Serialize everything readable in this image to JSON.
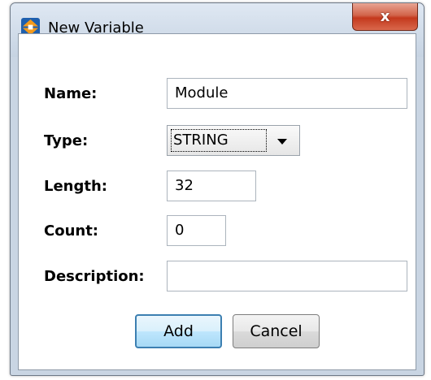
{
  "window": {
    "title": "New Variable",
    "close_label": "x"
  },
  "form": {
    "name": {
      "label": "Name:",
      "value": "Module"
    },
    "type": {
      "label": "Type:",
      "value": "STRING"
    },
    "length": {
      "label": "Length:",
      "value": "32"
    },
    "count": {
      "label": "Count:",
      "value": "0"
    },
    "description": {
      "label": "Description:",
      "value": ""
    }
  },
  "buttons": {
    "add": "Add",
    "cancel": "Cancel"
  },
  "colors": {
    "titlebar": "#c9d5e3",
    "close_button": "#c4391d",
    "default_button_border": "#3c7fb1",
    "app_icon_orange": "#f39a1c",
    "app_icon_blue": "#1e5fae"
  }
}
